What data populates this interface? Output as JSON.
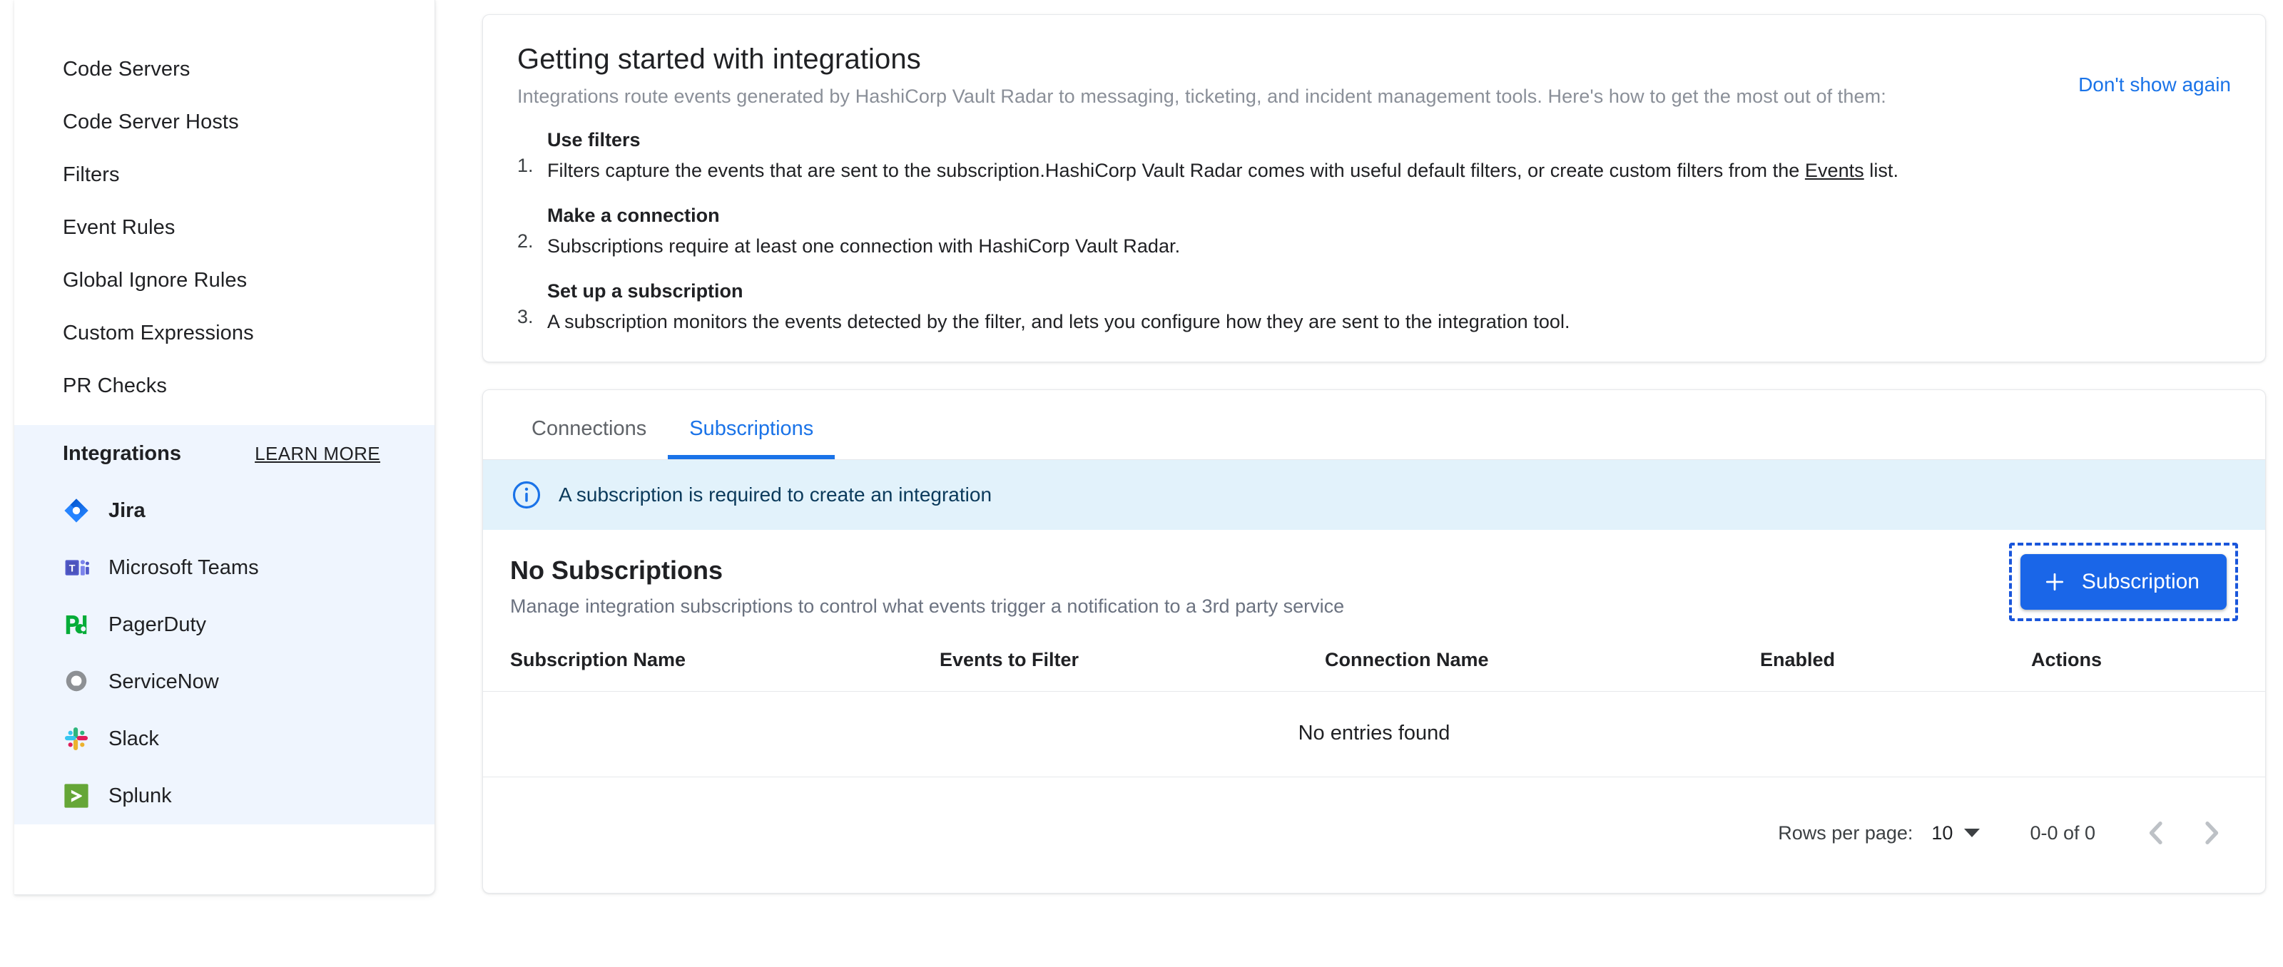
{
  "sidebar": {
    "nav_items": [
      {
        "label": "Code Servers"
      },
      {
        "label": "Code Server Hosts"
      },
      {
        "label": "Filters"
      },
      {
        "label": "Event Rules"
      },
      {
        "label": "Global Ignore Rules"
      },
      {
        "label": "Custom Expressions"
      },
      {
        "label": "PR Checks"
      }
    ],
    "integrations": {
      "title": "Integrations",
      "learn_more": "LEARN MORE",
      "items": [
        {
          "label": "Jira",
          "icon": "jira-icon",
          "active": true
        },
        {
          "label": "Microsoft Teams",
          "icon": "microsoft-teams-icon",
          "active": false
        },
        {
          "label": "PagerDuty",
          "icon": "pagerduty-icon",
          "active": false
        },
        {
          "label": "ServiceNow",
          "icon": "servicenow-icon",
          "active": false
        },
        {
          "label": "Slack",
          "icon": "slack-icon",
          "active": false
        },
        {
          "label": "Splunk",
          "icon": "splunk-icon",
          "active": false
        }
      ]
    }
  },
  "getting_started": {
    "title": "Getting started with integrations",
    "subtitle": "Integrations route events generated by HashiCorp Vault Radar to messaging, ticketing, and incident management tools. Here's how to get the most out of them:",
    "dismiss_label": "Don't show again",
    "steps": [
      {
        "number": "1.",
        "title": "Use filters",
        "desc_before": "Filters capture the events that are sent to the subscription.HashiCorp Vault Radar comes with useful default filters, or create custom filters from the ",
        "link": "Events",
        "desc_after": " list."
      },
      {
        "number": "2.",
        "title": "Make a connection",
        "desc_before": "Subscriptions require at least one connection with HashiCorp Vault Radar.",
        "link": "",
        "desc_after": ""
      },
      {
        "number": "3.",
        "title": "Set up a subscription",
        "desc_before": "A subscription monitors the events detected by the filter, and lets you configure how they are sent to the integration tool.",
        "link": "",
        "desc_after": ""
      }
    ]
  },
  "panel": {
    "tabs": [
      {
        "label": "Connections",
        "active": false
      },
      {
        "label": "Subscriptions",
        "active": true
      }
    ],
    "info_banner": {
      "icon": "info-circle-icon",
      "text": "A subscription is required to create an integration"
    },
    "list_header": {
      "title": "No Subscriptions",
      "subtitle": "Manage integration subscriptions to control what events trigger a notification to a 3rd party service",
      "add_button_label": "Subscription",
      "add_button_icon": "plus-icon"
    },
    "table": {
      "columns": [
        "Subscription Name",
        "Events to Filter",
        "Connection Name",
        "Enabled",
        "Actions"
      ],
      "rows": [],
      "empty_text": "No entries found"
    },
    "pagination": {
      "rows_per_page_label": "Rows per page:",
      "rows_per_page_value": "10",
      "range_label": "0-0 of 0",
      "prev_icon": "chevron-left-icon",
      "next_icon": "chevron-right-icon"
    }
  },
  "colors": {
    "accent_blue": "#1a73e8",
    "button_blue": "#1a66e8",
    "highlight_border": "#1a56db",
    "banner_bg": "#e2f2fb",
    "sidebar_active_bg": "#eff5fe"
  }
}
